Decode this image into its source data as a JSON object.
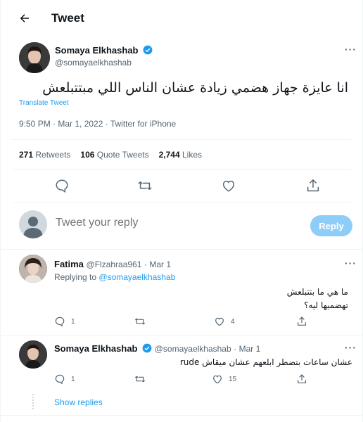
{
  "header": {
    "title": "Tweet"
  },
  "tweet": {
    "author_name": "Somaya Elkhashab",
    "author_handle": "@somayaelkhashab",
    "text": "انا عايزة جهاز هضمي زيادة عشان الناس اللي مبتتبلعش",
    "translate_label": "Translate Tweet",
    "meta": "9:50 PM · Mar 1, 2022 · Twitter for iPhone",
    "stats": {
      "retweets_count": "271",
      "retweets_label": "Retweets",
      "quotes_count": "106",
      "quotes_label": "Quote Tweets",
      "likes_count": "2,744",
      "likes_label": "Likes"
    }
  },
  "composer": {
    "placeholder": "Tweet your reply",
    "reply_button": "Reply"
  },
  "replies": [
    {
      "author_name": "Fatima",
      "author_handle": "@Flzahraa961",
      "date": "· Mar 1",
      "replying_prefix": "Replying to",
      "replying_to": "@somayaelkhashab",
      "text_line1": "ما هي ما بتتبلعش",
      "text_line2": "تهضميها ليه؟",
      "reply_count": "1",
      "retweet_count": "",
      "like_count": "4"
    },
    {
      "author_name": "Somaya Elkhashab",
      "author_handle": "@somayaelkhashab",
      "date": "· Mar 1",
      "text_line1": "عشان ساعات بتضطر ابلعهم عشان ميقاش rude",
      "reply_count": "1",
      "retweet_count": "",
      "like_count": "15"
    }
  ],
  "show_replies_label": "Show replies",
  "colors": {
    "accent": "#1d9bf0",
    "reply_button": "#8ecdf8",
    "muted": "#536471"
  }
}
